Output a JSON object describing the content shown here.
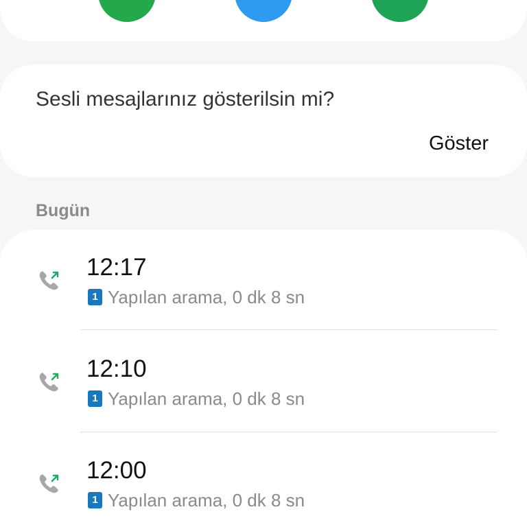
{
  "colors": {
    "call_green": "#23a84a",
    "message_blue": "#2e9af0",
    "video_green": "#1fa457",
    "sim_blue": "#1877bd",
    "outgoing_arrow": "#25a863",
    "phone_grey": "#a7a7a7"
  },
  "actions": [
    {
      "icon": "phone-icon"
    },
    {
      "icon": "message-icon"
    },
    {
      "icon": "video-call-icon"
    }
  ],
  "voicemail": {
    "question": "Sesli mesajlarınız gösterilsin mi?",
    "show_label": "Göster"
  },
  "section": {
    "title": "Bugün"
  },
  "calls": [
    {
      "time": "12:17",
      "sim": "1",
      "description": "Yapılan arama, 0 dk 8 sn",
      "icon": "outgoing-call-icon"
    },
    {
      "time": "12:10",
      "sim": "1",
      "description": "Yapılan arama, 0 dk 8 sn",
      "icon": "outgoing-call-icon"
    },
    {
      "time": "12:00",
      "sim": "1",
      "description": "Yapılan arama, 0 dk 8 sn",
      "icon": "outgoing-call-icon"
    }
  ]
}
